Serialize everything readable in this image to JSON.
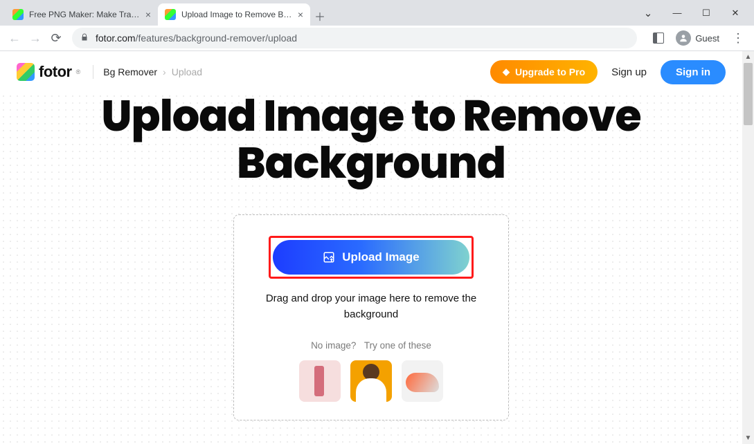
{
  "browser": {
    "tabs": [
      {
        "title": "Free PNG Maker: Make Transp",
        "active": false
      },
      {
        "title": "Upload Image to Remove Back",
        "active": true
      }
    ],
    "url_host": "fotor.com",
    "url_path": "/features/background-remover/upload",
    "profile_label": "Guest"
  },
  "header": {
    "brand": "fotor",
    "crumb_root": "Bg Remover",
    "crumb_current": "Upload",
    "upgrade_label": "Upgrade to Pro",
    "signup_label": "Sign up",
    "signin_label": "Sign in"
  },
  "hero": {
    "title": "Upload Image to Remove Background"
  },
  "dropzone": {
    "upload_button": "Upload Image",
    "hint": "Drag and drop your image here to remove the background",
    "no_image": "No image?",
    "try_one": "Try one of these",
    "samples": [
      {
        "name": "sample-product"
      },
      {
        "name": "sample-portrait"
      },
      {
        "name": "sample-shoe"
      }
    ]
  }
}
